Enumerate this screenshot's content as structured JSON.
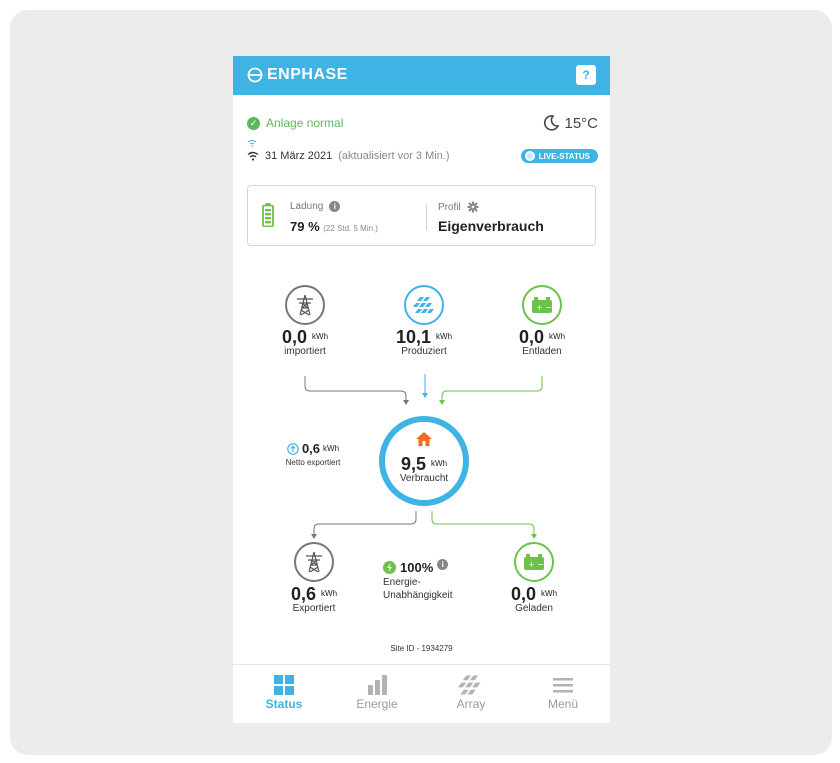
{
  "app": {
    "brand": "ENPHASE",
    "help_label": "?"
  },
  "status": {
    "text": "Anlage normal",
    "temperature": "15°C"
  },
  "update": {
    "date": "31 März 2021",
    "updated": "(aktualisiert vor 3 Min.)",
    "live_label": "LIVE-STATUS"
  },
  "card": {
    "charge_label": "Ladung",
    "charge_value": "79 %",
    "charge_time": "(22 Std. 5 Min.)",
    "profile_label": "Profil",
    "profile_value": "Eigenverbrauch"
  },
  "flow": {
    "imported": {
      "value": "0,0",
      "unit": "kWh",
      "label": "importiert"
    },
    "produced": {
      "value": "10,1",
      "unit": "kWh",
      "label": "Produziert"
    },
    "discharged": {
      "value": "0,0",
      "unit": "kWh",
      "label": "Entladen"
    },
    "consumed": {
      "value": "9,5",
      "unit": "kWh",
      "label": "Verbraucht"
    },
    "net_export": {
      "value": "0,6",
      "unit": "kWh",
      "label": "Netto exportiert"
    },
    "exported": {
      "value": "0,6",
      "unit": "kWh",
      "label": "Exportiert"
    },
    "independence": {
      "value": "100%",
      "label_line1": "Energie-",
      "label_line2": "Unabhängigkeit"
    },
    "charged": {
      "value": "0,0",
      "unit": "kWh",
      "label": "Geladen"
    }
  },
  "site_id": "Site ID - 1934279",
  "tabs": [
    {
      "label": "Status",
      "icon": "grid-icon",
      "active": true
    },
    {
      "label": "Energie",
      "icon": "bar-chart-icon",
      "active": false
    },
    {
      "label": "Array",
      "icon": "solar-array-icon",
      "active": false
    },
    {
      "label": "Menü",
      "icon": "menu-icon",
      "active": false
    }
  ],
  "colors": {
    "accent": "#3fb3e3",
    "ok": "#5cb85c",
    "battery": "#6cc24a",
    "home": "#f26b21",
    "grid": "#777777"
  }
}
